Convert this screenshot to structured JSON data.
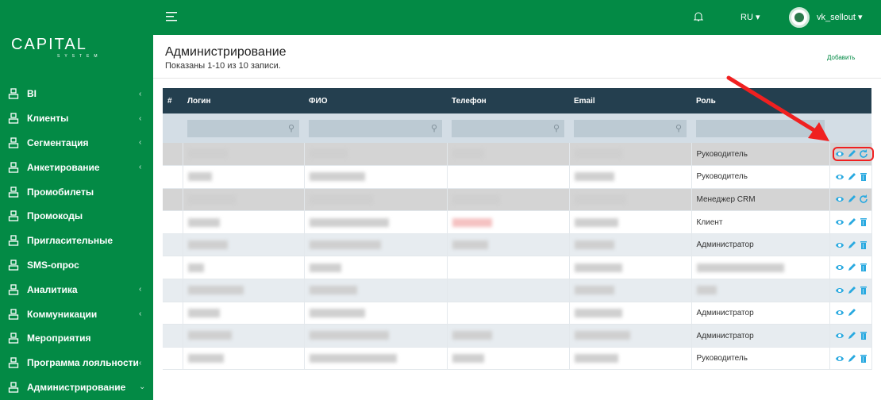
{
  "brand": {
    "name": "CAPITAL",
    "tagline": "SYSTEM",
    "color": "#038a45"
  },
  "sidebar": {
    "items": [
      {
        "label": "BI",
        "icon": "chart-line-icon",
        "chevron": true
      },
      {
        "label": "Клиенты",
        "icon": "user-icon",
        "chevron": true
      },
      {
        "label": "Сегментация",
        "icon": "sitemap-icon",
        "chevron": true
      },
      {
        "label": "Анкетирование",
        "icon": "file-check-icon",
        "chevron": true
      },
      {
        "label": "Промобилеты",
        "icon": "ticket-icon",
        "chevron": false
      },
      {
        "label": "Промокоды",
        "icon": "percent-ticket-icon",
        "chevron": false
      },
      {
        "label": "Пригласительные",
        "icon": "user-icon",
        "chevron": false
      },
      {
        "label": "SMS-опрос",
        "icon": "user-icon",
        "chevron": false
      },
      {
        "label": "Аналитика",
        "icon": "bar-chart-icon",
        "chevron": true
      },
      {
        "label": "Коммуникации",
        "icon": "mail-icon",
        "chevron": true
      },
      {
        "label": "Мероприятия",
        "icon": "megaphone-icon",
        "chevron": false
      },
      {
        "label": "Программа лояльности",
        "icon": "gift-icon",
        "chevron": true
      },
      {
        "label": "Администрирование",
        "icon": "user-icon",
        "chevron": true,
        "expanded": true
      }
    ]
  },
  "topbar": {
    "lang": "RU",
    "user": "vk_sellout"
  },
  "page": {
    "title": "Администрирование",
    "summary": "Показаны 1-10 из 10 записи.",
    "add_label": "Добавить"
  },
  "table": {
    "columns": [
      "#",
      "Логин",
      "ФИО",
      "Телефон",
      "Email",
      "Роль",
      ""
    ],
    "rows": [
      {
        "role": "Руководитель",
        "style": "g",
        "actions": [
          "view",
          "edit",
          "restore"
        ]
      },
      {
        "role": "Руководитель",
        "style": "w",
        "actions": [
          "view",
          "edit",
          "delete"
        ]
      },
      {
        "role": "Менеджер CRM",
        "style": "g",
        "actions": [
          "view",
          "edit",
          "restore"
        ]
      },
      {
        "role": "Клиент",
        "style": "w",
        "actions": [
          "view",
          "edit",
          "delete"
        ]
      },
      {
        "role": "Администратор",
        "style": "b",
        "actions": [
          "view",
          "edit",
          "delete"
        ]
      },
      {
        "role": "",
        "style": "w",
        "actions": [
          "view",
          "edit",
          "delete"
        ]
      },
      {
        "role": "",
        "style": "b",
        "actions": [
          "view",
          "edit",
          "delete"
        ]
      },
      {
        "role": "Администратор",
        "style": "w",
        "actions": [
          "view",
          "edit"
        ]
      },
      {
        "role": "Администратор",
        "style": "b",
        "actions": [
          "view",
          "edit",
          "delete"
        ]
      },
      {
        "role": "Руководитель",
        "style": "w",
        "actions": [
          "view",
          "edit",
          "delete"
        ]
      }
    ]
  },
  "colors": {
    "action": "#29a9e0",
    "header": "#243f4f",
    "highlight": "#f02020"
  }
}
